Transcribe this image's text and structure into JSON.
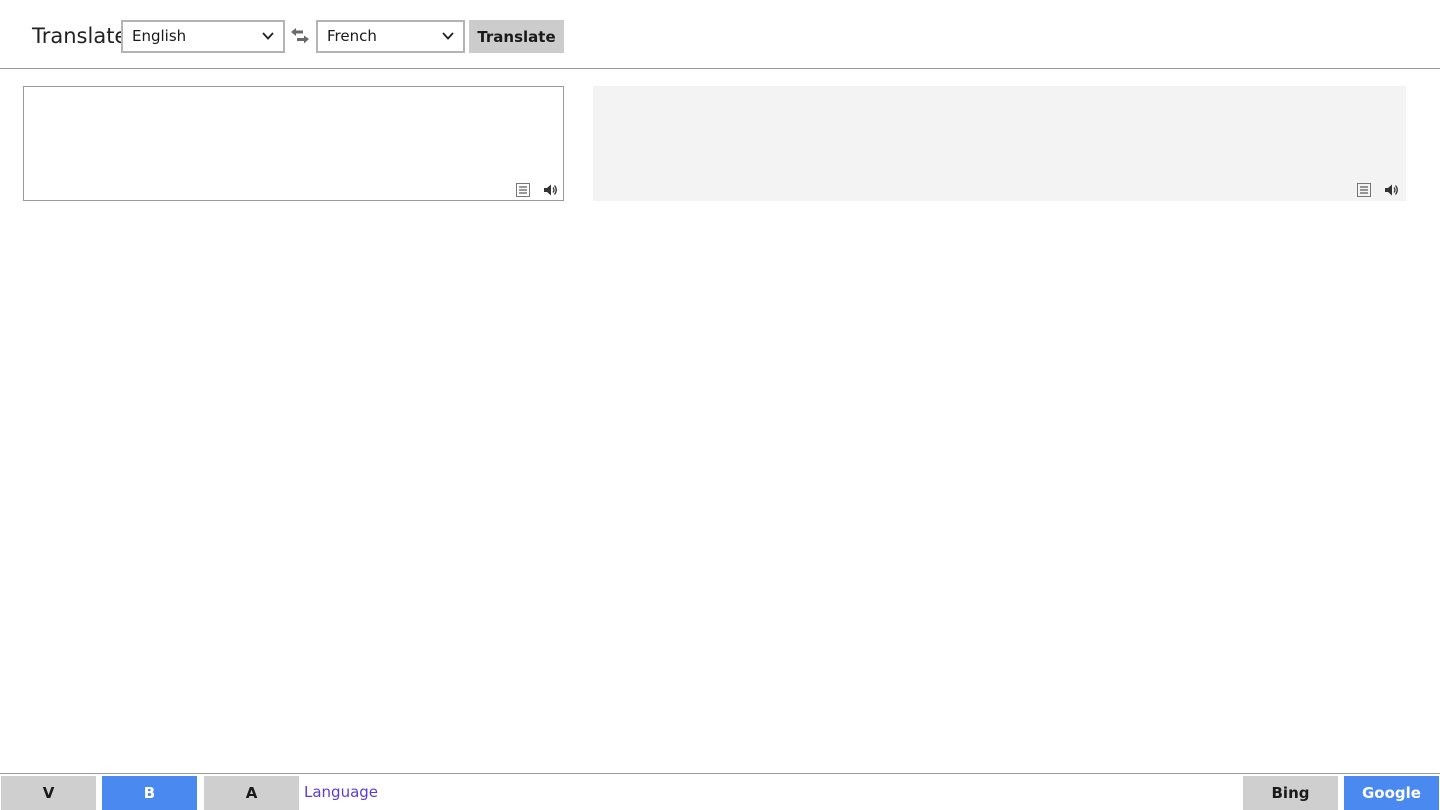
{
  "header": {
    "title": "Translate",
    "source_language": "English",
    "target_language": "French",
    "translate_label": "Translate"
  },
  "source_pane": {
    "value": "",
    "icons": [
      "list-icon",
      "speaker-icon"
    ]
  },
  "output_pane": {
    "value": "",
    "icons": [
      "list-icon",
      "speaker-icon"
    ]
  },
  "footer": {
    "mode_buttons": [
      {
        "label": "V",
        "active": false
      },
      {
        "label": "B",
        "active": true
      },
      {
        "label": "A",
        "active": false
      }
    ],
    "language_link": "Language",
    "engines": [
      {
        "label": "Bing",
        "active": false
      },
      {
        "label": "Google",
        "active": true
      }
    ]
  },
  "colors": {
    "active_blue": "#4a89f0",
    "inactive_grey": "#cfcfcf",
    "link_purple": "#5b3bd6",
    "output_bg": "#f3f3f3"
  }
}
